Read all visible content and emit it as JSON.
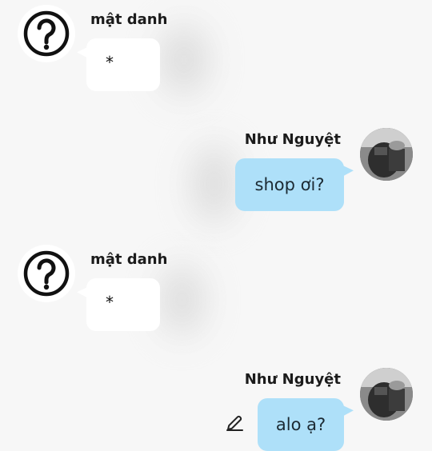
{
  "messages": [
    {
      "sender": "mật danh",
      "side": "left",
      "text": "*",
      "avatar_icon": "question-mark-icon"
    },
    {
      "sender": "Như Nguyệt",
      "side": "right",
      "text": "shop ơi?",
      "avatar": "user-photo"
    },
    {
      "sender": "mật danh",
      "side": "left",
      "text": "*",
      "avatar_icon": "question-mark-icon"
    },
    {
      "sender": "Như Nguyệt",
      "side": "right",
      "text": "alo ạ?",
      "avatar": "user-photo",
      "action_icon": "edit-pencil-icon"
    }
  ],
  "colors": {
    "background": "#f7f7f7",
    "outgoing_bubble": "#aee0f9",
    "incoming_bubble": "#ffffff"
  }
}
